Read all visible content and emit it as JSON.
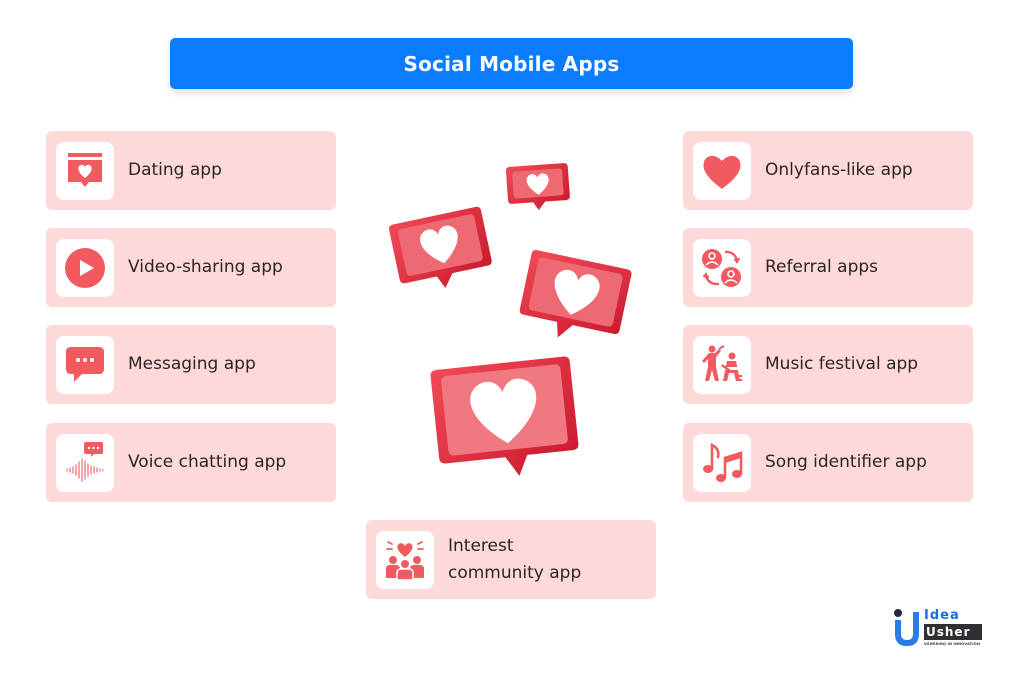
{
  "title": "Social Mobile Apps",
  "colors": {
    "title_bg": "#0a7cff",
    "card_bg": "#fed9da",
    "icon_accent": "#f15a5e",
    "text": "#2b2326"
  },
  "left_column": [
    {
      "label": "Dating app",
      "icon": "dating-heart-chat-icon"
    },
    {
      "label": "Video-sharing app",
      "icon": "play-button-icon"
    },
    {
      "label": "Messaging app",
      "icon": "chat-bubble-icon"
    },
    {
      "label": "Voice chatting app",
      "icon": "voice-wave-chat-icon"
    }
  ],
  "right_column": [
    {
      "label": "Onlyfans-like app",
      "icon": "heart-icon"
    },
    {
      "label": "Referral apps",
      "icon": "referral-users-icon"
    },
    {
      "label": "Music festival app",
      "icon": "performers-icon"
    },
    {
      "label": "Song identifier app",
      "icon": "music-notes-icon"
    }
  ],
  "bottom": {
    "label": "Interest\ncommunity app",
    "icon": "community-heart-icon"
  },
  "center_graphic": "heart-like-notification-bubbles",
  "logo": {
    "line1": "Idea",
    "line2": "Usher",
    "tagline": "USHERING IN INNOVATION"
  }
}
